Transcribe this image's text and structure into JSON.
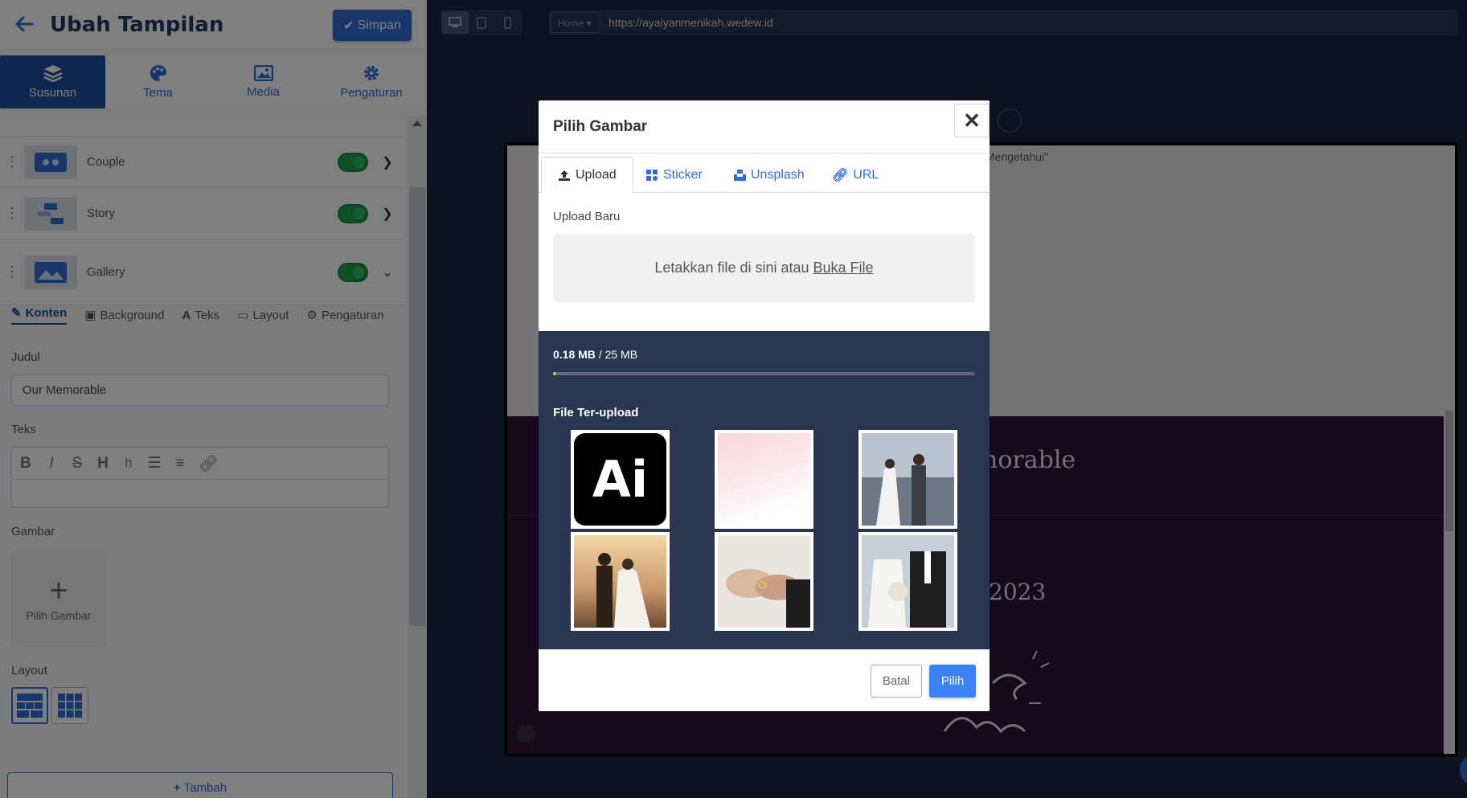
{
  "header": {
    "title": "Ubah Tampilan",
    "save_label": "Simpan"
  },
  "main_tabs": [
    {
      "label": "Susunan",
      "icon": "layers-icon",
      "active": true
    },
    {
      "label": "Tema",
      "icon": "palette-icon",
      "active": false
    },
    {
      "label": "Media",
      "icon": "images-icon",
      "active": false
    },
    {
      "label": "Pengaturan",
      "icon": "gear-icon",
      "active": false
    }
  ],
  "sections": [
    {
      "label": "Couple",
      "enabled": true,
      "expanded": false
    },
    {
      "label": "Story",
      "enabled": true,
      "expanded": false
    },
    {
      "label": "Gallery",
      "enabled": true,
      "expanded": true
    }
  ],
  "gallery_tabs": [
    {
      "label": "Konten",
      "icon": "edit-icon",
      "active": true
    },
    {
      "label": "Background",
      "icon": "image-icon",
      "active": false
    },
    {
      "label": "Teks",
      "icon": "text-icon",
      "active": false
    },
    {
      "label": "Layout",
      "icon": "window-icon",
      "active": false
    },
    {
      "label": "Pengaturan",
      "icon": "gear-icon",
      "active": false
    }
  ],
  "form": {
    "title_label": "Judul",
    "title_value": "Our Memorable",
    "text_label": "Teks",
    "image_label": "Gambar",
    "add_image_label": "Pilih Gambar",
    "layout_label": "Layout",
    "add_button": "Tambah"
  },
  "preview": {
    "page_select": "Home",
    "url": "https://ayaiyanmenikah.wedew.id",
    "partial_text": "Mengetahui\"",
    "heading_fragment": "norable",
    "date_fragment": "2023"
  },
  "modal": {
    "title": "Pilih Gambar",
    "tabs": [
      {
        "label": "Upload",
        "icon": "upload-icon",
        "active": true
      },
      {
        "label": "Sticker",
        "icon": "sticker-icon",
        "active": false
      },
      {
        "label": "Unsplash",
        "icon": "unsplash-icon",
        "active": false
      },
      {
        "label": "URL",
        "icon": "link-icon",
        "active": false
      }
    ],
    "upload_label": "Upload Baru",
    "dropzone_text": "Letakkan file di sini atau",
    "dropzone_link": "Buka File",
    "storage_used": "0.18 MB",
    "storage_total": "/ 25 MB",
    "storage_fraction": 0.0072,
    "uploaded_label": "File Ter-upload",
    "images": [
      {
        "name": "illustrator-logo",
        "text": "Ai"
      },
      {
        "name": "pink-watercolor-background"
      },
      {
        "name": "couple-holding-hands-sea"
      },
      {
        "name": "couple-sunset-field"
      },
      {
        "name": "hands-with-rings"
      },
      {
        "name": "bride-groom-bouquet"
      }
    ],
    "cancel_label": "Batal",
    "select_label": "Pilih"
  },
  "colors": {
    "primary": "#2f6fd6",
    "active_tab": "#1f4f9c",
    "toggle_on": "#1fa04e",
    "modal_dark": "#2a3550",
    "progress": "#f4c01e"
  }
}
